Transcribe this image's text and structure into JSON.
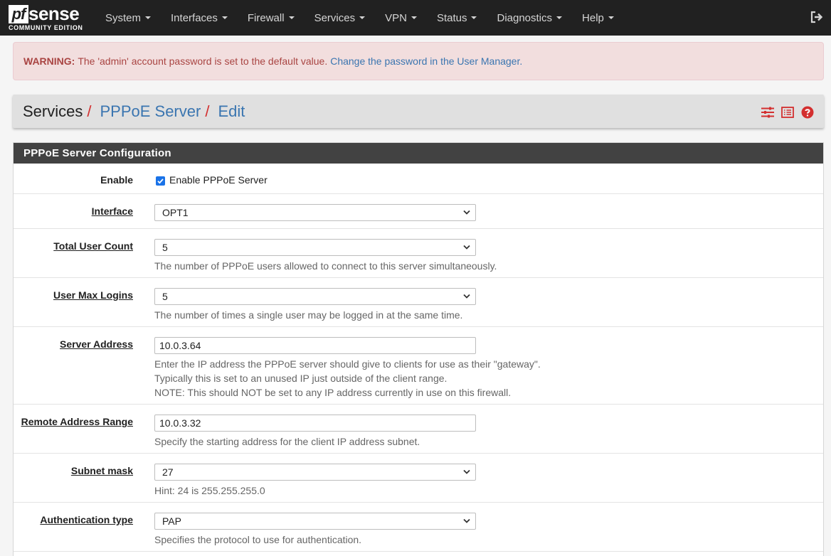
{
  "navbar": {
    "logo_mark": "pf",
    "logo_word": "sense",
    "logo_sub": "COMMUNITY EDITION",
    "menu": [
      {
        "label": "System"
      },
      {
        "label": "Interfaces"
      },
      {
        "label": "Firewall"
      },
      {
        "label": "Services"
      },
      {
        "label": "VPN"
      },
      {
        "label": "Status"
      },
      {
        "label": "Diagnostics"
      },
      {
        "label": "Help"
      }
    ]
  },
  "alert": {
    "strong": "WARNING:",
    "text": "The 'admin' account password is set to the default value.",
    "link": "Change the password in the User Manager."
  },
  "breadcrumb": {
    "items": [
      "Services",
      "PPPoE Server",
      "Edit"
    ],
    "separator": "/"
  },
  "panel": {
    "title": "PPPoE Server Configuration",
    "enable": {
      "label": "Enable",
      "checkbox_label": "Enable PPPoE Server",
      "checked": true
    },
    "interface": {
      "label": "Interface",
      "value": "OPT1"
    },
    "total_user_count": {
      "label": "Total User Count",
      "value": "5",
      "help": "The number of PPPoE users allowed to connect to this server simultaneously."
    },
    "user_max_logins": {
      "label": "User Max Logins",
      "value": "5",
      "help": "The number of times a single user may be logged in at the same time."
    },
    "server_address": {
      "label": "Server Address",
      "value": "10.0.3.64",
      "help1": "Enter the IP address the PPPoE server should give to clients for use as their \"gateway\".",
      "help2": "Typically this is set to an unused IP just outside of the client range.",
      "help3": "NOTE: This should NOT be set to any IP address currently in use on this firewall."
    },
    "remote_address_range": {
      "label": "Remote Address Range",
      "value": "10.0.3.32",
      "help": "Specify the starting address for the client IP address subnet."
    },
    "subnet_mask": {
      "label": "Subnet mask",
      "value": "27",
      "help": "Hint: 24 is 255.255.255.0"
    },
    "auth_type": {
      "label": "Authentication type",
      "value": "PAP",
      "help": "Specifies the protocol to use for authentication."
    }
  },
  "colors": {
    "accent_red": "#d32f2f",
    "link_blue": "#3a75b0",
    "navbar": "#212121"
  }
}
